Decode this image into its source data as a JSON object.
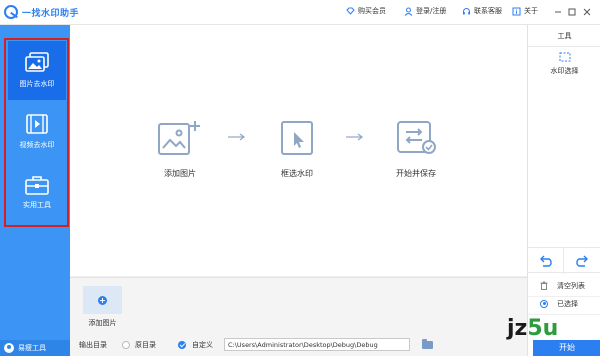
{
  "app": {
    "title": "一找水印助手"
  },
  "titlebar": {
    "vip": "购买会员",
    "login": "登录/注册",
    "support": "联系客服",
    "about": "关于"
  },
  "sidebar": {
    "items": [
      {
        "label": "图片去水印",
        "icon": "image-icon",
        "active": true
      },
      {
        "label": "视频去水印",
        "icon": "film-icon",
        "active": false
      },
      {
        "label": "实用工具",
        "icon": "toolbox-icon",
        "active": false
      }
    ],
    "easy_tool": "易瘦工具"
  },
  "steps": [
    {
      "label": "添加图片",
      "icon": "add-image-icon"
    },
    {
      "label": "框选水印",
      "icon": "select-cursor-icon"
    },
    {
      "label": "开始并保存",
      "icon": "save-check-icon"
    }
  ],
  "thumbs": {
    "add_label": "添加图片"
  },
  "output": {
    "label": "输出目录",
    "original": "原目录",
    "custom": "自定义",
    "path": "C:\\Users\\Administrator\\Desktop\\Debug\\Debug",
    "selected": "custom"
  },
  "right_panel": {
    "title": "工具",
    "tool_label": "水印选择",
    "clear_list": "清空列表",
    "selected": "已选择",
    "start": "开始"
  },
  "watermark": {
    "text_a": "jz",
    "text_b": "5u"
  },
  "colors": {
    "accent": "#2c7ff1",
    "sidebar": "#3c94f4",
    "sidebar_active": "#1a6de9",
    "highlight_frame": "#d32020",
    "step_icon": "#8fa7c4"
  }
}
